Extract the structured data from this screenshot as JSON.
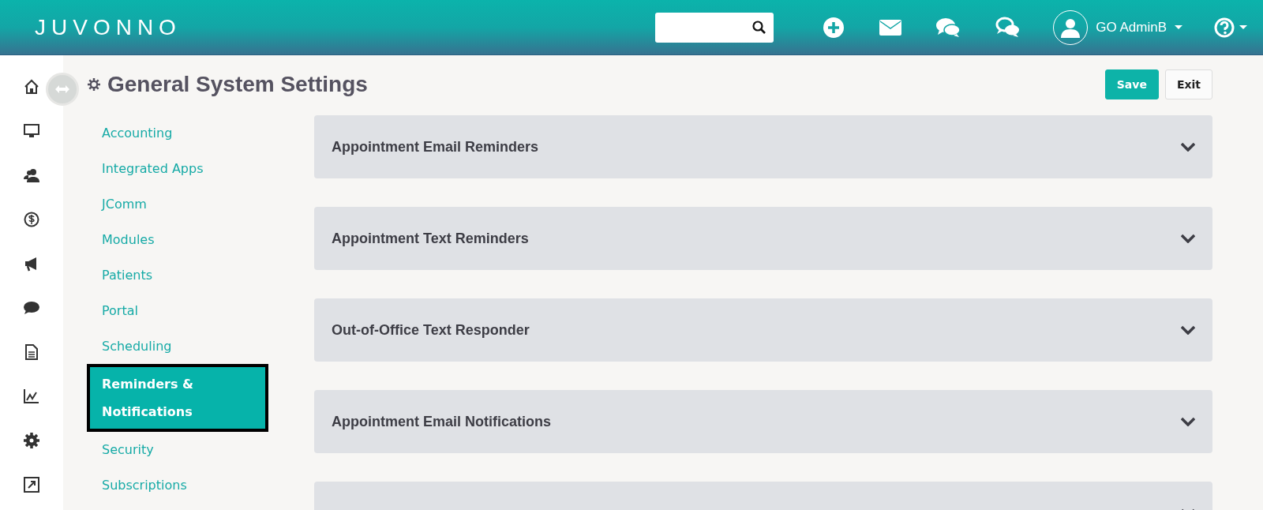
{
  "header": {
    "logo": "JUVONNO",
    "user": {
      "name": "GO AdminB"
    }
  },
  "rail": {
    "items": [
      {
        "kind": "home"
      },
      {
        "kind": "monitor"
      },
      {
        "kind": "people"
      },
      {
        "kind": "dollar"
      },
      {
        "kind": "megaphone"
      },
      {
        "kind": "chat"
      },
      {
        "kind": "document"
      },
      {
        "kind": "chart"
      },
      {
        "kind": "gear"
      },
      {
        "kind": "external"
      }
    ]
  },
  "page": {
    "title": "General System Settings",
    "buttons": [
      {
        "label": "Save",
        "kind": "primary"
      },
      {
        "label": "Exit",
        "kind": "default"
      }
    ]
  },
  "sidebar": {
    "items": [
      {
        "label": "Accounting",
        "selected": false
      },
      {
        "label": "Integrated Apps",
        "selected": false
      },
      {
        "label": "JComm",
        "selected": false
      },
      {
        "label": "Modules",
        "selected": false
      },
      {
        "label": "Patients",
        "selected": false
      },
      {
        "label": "Portal",
        "selected": false
      },
      {
        "label": "Scheduling",
        "selected": false
      },
      {
        "label": "Reminders & Notifications",
        "selected": true
      },
      {
        "label": "Security",
        "selected": false
      },
      {
        "label": "Subscriptions",
        "selected": false
      }
    ]
  },
  "panels": [
    {
      "title": "Appointment Email Reminders",
      "expanded": false
    },
    {
      "title": "Appointment Text Reminders",
      "expanded": false
    },
    {
      "title": "Out-of-Office Text Responder",
      "expanded": false
    },
    {
      "title": "Appointment Email Notifications",
      "expanded": false
    },
    {
      "expanded": false
    }
  ]
}
